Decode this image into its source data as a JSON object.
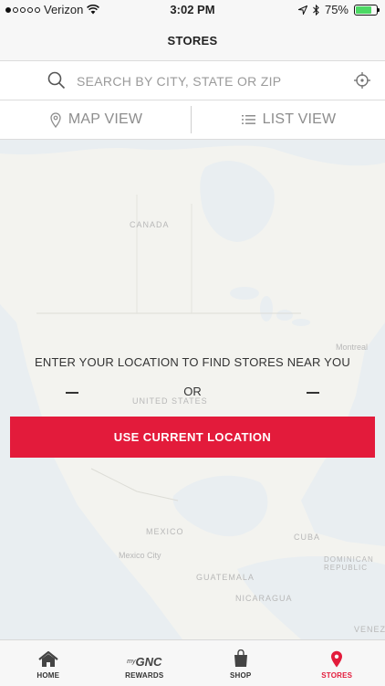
{
  "status_bar": {
    "carrier": "Verizon",
    "time": "3:02 PM",
    "battery": "75%",
    "battery_level": 0.75,
    "signal_bars": 1
  },
  "header": {
    "title": "STORES"
  },
  "search": {
    "placeholder": "SEARCH BY CITY, STATE OR ZIP",
    "value": ""
  },
  "view_toggle": {
    "map_label": "MAP VIEW",
    "list_label": "LIST VIEW"
  },
  "map": {
    "labels": [
      "CANADA",
      "UNITED STATES",
      "MEXICO",
      "Mexico City",
      "CUBA",
      "GUATEMALA",
      "NICARAGUA",
      "Montreal",
      "DOMINICAN REPUBLIC",
      "VENEZU"
    ],
    "water_color": "#e9eef1",
    "land_color": "#f3f3ef"
  },
  "location_prompt": {
    "message": "ENTER YOUR LOCATION TO FIND STORES NEAR YOU",
    "or": "OR",
    "button": "USE CURRENT LOCATION"
  },
  "tabs": [
    {
      "label": "HOME",
      "icon": "home-icon",
      "active": false
    },
    {
      "label": "REWARDS",
      "icon": "mygnc-logo",
      "active": false,
      "logo_text": "GNC",
      "logo_prefix": "my"
    },
    {
      "label": "SHOP",
      "icon": "shopping-bag-icon",
      "active": false
    },
    {
      "label": "STORES",
      "icon": "location-pin-icon",
      "active": true
    }
  ],
  "colors": {
    "accent": "#e31b3b",
    "text": "#333333",
    "muted": "#8d8d8d"
  }
}
